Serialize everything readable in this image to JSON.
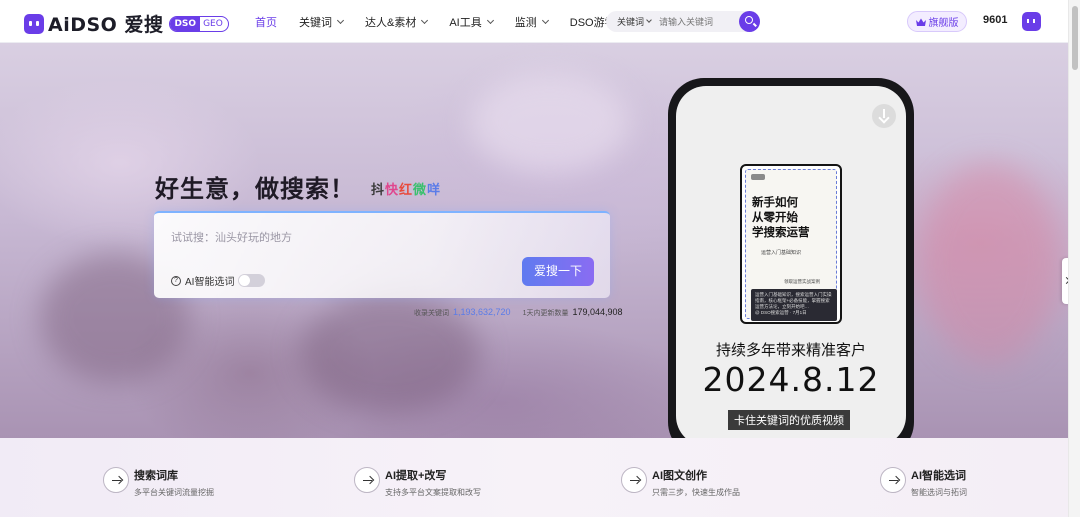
{
  "header": {
    "logo_text": "AiDSO 爱搜",
    "logo_badge_left": "DSO",
    "logo_badge_right": "GEO",
    "nav": [
      {
        "label": "首页",
        "active": true,
        "dropdown": false
      },
      {
        "label": "关键词",
        "active": false,
        "dropdown": true
      },
      {
        "label": "达人&素材",
        "active": false,
        "dropdown": true
      },
      {
        "label": "AI工具",
        "active": false,
        "dropdown": true
      },
      {
        "label": "监测",
        "active": false,
        "dropdown": true
      },
      {
        "label": "DSO游学",
        "active": false,
        "dropdown": false
      }
    ],
    "search": {
      "type_label": "关键词",
      "placeholder": "请输入关键词"
    },
    "flag_label": "旗舰版",
    "points": "9601",
    "accent": "#6a3de8"
  },
  "hero": {
    "title": "好生意，做搜索！",
    "platforms": [
      "抖",
      "快",
      "红",
      "微",
      "咩"
    ],
    "search_placeholder": "试试搜：汕头好玩的地方",
    "ai_pick_label": "AI智能选词",
    "search_button": "爱搜一下",
    "stats": {
      "keywords_label": "收录关键词",
      "keywords_value": "1,193,632,720",
      "updated_label": "1天内更新数量",
      "updated_value": "179,044,908"
    }
  },
  "phone": {
    "cover_title_1": "新手如何",
    "cover_title_2": "从零开始",
    "cover_title_3": "学搜索运营",
    "cover_sub": "运营入门基础知识",
    "cover_link": "领取运营实战案例",
    "cover_note": "运营入门基础知识，搜索运营入门实操指南，核心框架+必备技能，掌握搜索运营方法论，立刻开始吧…",
    "cover_author": "@ DSO搜索运营 · 7月1日",
    "caption_1": "持续多年带来精准客户",
    "caption_date": "2024.8.12",
    "caption_2": "卡住关键词的优质视频"
  },
  "features": [
    {
      "title": "搜索词库",
      "desc": "多平台关键词流量挖掘"
    },
    {
      "title": "AI提取+改写",
      "desc": "支持多平台文案提取和改写"
    },
    {
      "title": "AI图文创作",
      "desc": "只需三步，快速生成作品"
    },
    {
      "title": "AI智能选词",
      "desc": "智能选词与拓词"
    }
  ]
}
